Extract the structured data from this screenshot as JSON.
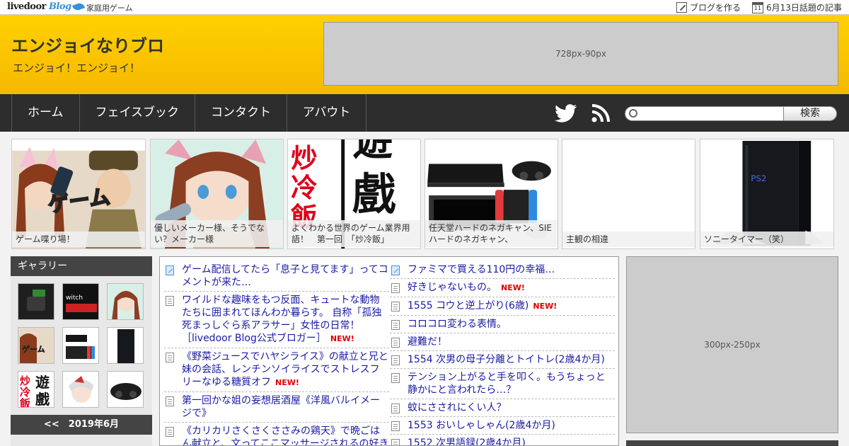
{
  "topbar": {
    "logo_main": "livedoor",
    "logo_blog": "Blog",
    "category": "家庭用ゲーム",
    "make_blog": "ブログを作る",
    "calendar_day": "11",
    "topics": "6月13日話題の記事"
  },
  "header": {
    "title": "エンジョイなりブロ",
    "description": "エンジョイ！エンジョイ！",
    "ad_label": "728px-90px"
  },
  "nav": {
    "items": [
      "ホーム",
      "フェイスブック",
      "コンタクト",
      "アバウト"
    ],
    "search_button": "検索",
    "search_placeholder": ""
  },
  "featured": [
    {
      "caption": "ゲーム喋り場！",
      "image": "anime-game-characters"
    },
    {
      "caption": "優しいメーカー様、そうでない？メーカー様",
      "image": "anime-girl-bandage"
    },
    {
      "caption": "よくわかる世界のゲーム業界用語！　第一回　「炒冷飯」",
      "image": "kanji-calligraphy",
      "kanji": [
        "炒",
        "冷",
        "飯",
        "遊",
        "戲"
      ]
    },
    {
      "caption": "任天堂ハードのネガキャン、SIEハードのネガキャン、",
      "image": "ps4-and-switch"
    },
    {
      "caption": "主観の相違",
      "image": "blank"
    },
    {
      "caption": "ソニータイマー（笑）",
      "image": "ps2-console"
    }
  ],
  "gallery": {
    "heading": "ギャラリー",
    "month_label": "<<　2019年6月"
  },
  "articles": {
    "left": [
      {
        "text": "ゲーム配信してたら「息子と見てます」ってコメントが来た…",
        "icon": "blog-icon",
        "new": false
      },
      {
        "text": "ワイルドな趣味をもつ反面、キュートな動物たちに囲まれてほんわか暮らす。 自称「孤独死まっしぐら系アラサー」女性の日常！［livedoor Blog公式ブロガー］",
        "icon": "page-icon",
        "new": true
      },
      {
        "text": "《野菜ジュースでハヤシライス》の献立と兄と妹の会話、レンチンソイライスでストレスフリーなゆる糖質オフ",
        "icon": "page-icon",
        "new": true
      },
      {
        "text": "第一回かな姐の妄想居酒屋《洋風バルイメージで》",
        "icon": "page-icon",
        "new": false
      },
      {
        "text": "《カリカリさくさくささみの鶏天》で晩ごはん献立と、文ってここマッサージされるの好きだ",
        "icon": "page-icon",
        "new": false
      }
    ],
    "right": [
      {
        "text": "ファミマで買える110円の幸福…",
        "icon": "blog-icon",
        "new": false
      },
      {
        "text": "好きじゃないもの。",
        "icon": "page-icon",
        "new": true
      },
      {
        "text": "1555 コウと逆上がり(6歳)",
        "icon": "page-icon",
        "new": true
      },
      {
        "text": "コロコロ変わる表情。",
        "icon": "page-icon",
        "new": false
      },
      {
        "text": "避難だ！",
        "icon": "page-icon",
        "new": false
      },
      {
        "text": "1554 次男の母子分離とトイトレ(2歳4か月)",
        "icon": "page-icon",
        "new": false
      },
      {
        "text": "テンション上がると手を叩く。もうちょっと静かにと言われたら…？",
        "icon": "page-icon",
        "new": false
      },
      {
        "text": "蚊にさされにくい人？",
        "icon": "page-icon",
        "new": false
      },
      {
        "text": "1553 おいしゃしゃん(2歳4か月)",
        "icon": "page-icon",
        "new": false
      },
      {
        "text": "1552 次男語録(2歳4か月)",
        "icon": "page-icon",
        "new": false
      }
    ],
    "new_label": "NEW!"
  },
  "side_ad": {
    "label": "300px-250px"
  },
  "colors": {
    "header_yellow": "#ffd100",
    "nav_dark": "#2d2d2d",
    "link_blue": "#1a1aa6",
    "new_red": "#e00000"
  }
}
